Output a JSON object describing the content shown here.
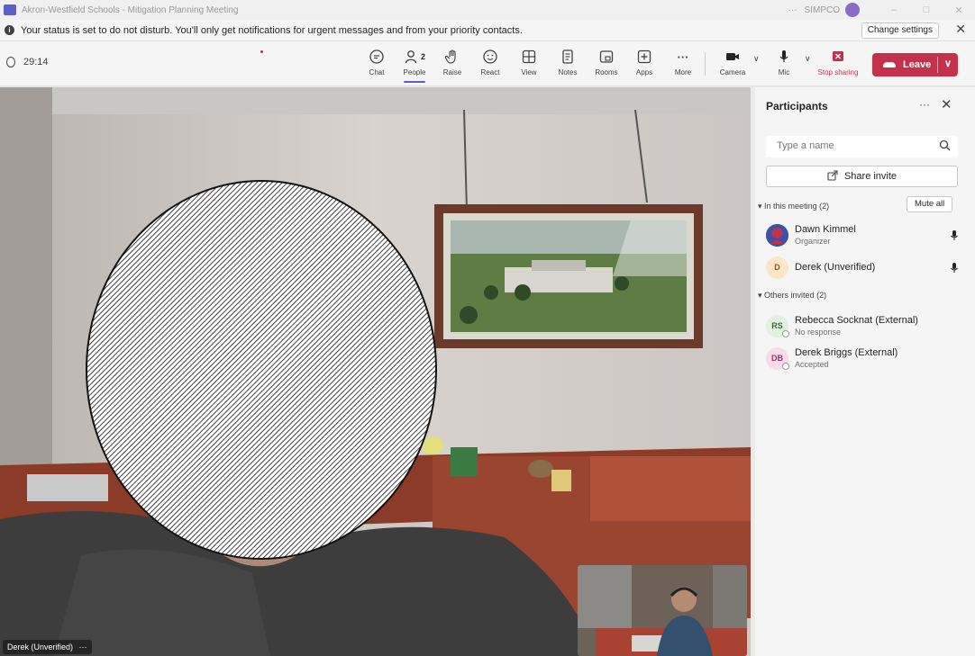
{
  "window": {
    "title": "Akron-Westfield Schools - Mitigation Planning Meeting",
    "overflow_glyph": "···",
    "org": "SIMPCO",
    "minimize_glyph": "–",
    "maximize_glyph": "□",
    "close_glyph": "✕"
  },
  "banner": {
    "message": "Your status is set to do not disturb. You'll only get notifications for urgent messages and from your priority contacts.",
    "change_settings_label": "Change settings",
    "close_glyph": "✕"
  },
  "toolbar": {
    "timer": "29:14",
    "chat_label": "Chat",
    "people_label": "People",
    "people_count": "2",
    "raise_label": "Raise",
    "react_label": "React",
    "view_label": "View",
    "notes_label": "Notes",
    "rooms_label": "Rooms",
    "apps_label": "Apps",
    "more_label": "More",
    "more_glyph": "···",
    "camera_label": "Camera",
    "mic_label": "Mic",
    "stop_sharing_label": "Stop sharing",
    "leave_label": "Leave",
    "chevron_glyph": "∨"
  },
  "stage": {
    "speaker_name": "Derek (Unverified)",
    "speaker_more_glyph": "···"
  },
  "participants_panel": {
    "title": "Participants",
    "more_glyph": "···",
    "close_glyph": "✕",
    "search_placeholder": "Type a name",
    "share_invite_label": "Share invite",
    "in_meeting_header": "In this meeting (2)",
    "mute_all_label": "Mute all",
    "in_meeting": [
      {
        "name": "Dawn Kimmel",
        "role": "Organizer",
        "initials": "",
        "avatar_color": "#c4314b"
      },
      {
        "name": "Derek (Unverified)",
        "role": "",
        "initials": "D",
        "avatar_color": "#fce6c8"
      }
    ],
    "others_header": "Others invited (2)",
    "others": [
      {
        "name": "Rebecca Socknat (External)",
        "status": "No response",
        "initials": "RS",
        "avatar_color": "#e3efe0"
      },
      {
        "name": "Derek Briggs (External)",
        "status": "Accepted",
        "initials": "DB",
        "avatar_color": "#f9dbe8"
      }
    ]
  },
  "colors": {
    "accent": "#5b5fc7",
    "leave_red": "#c4314b",
    "panel_bg": "#f5f5f5"
  }
}
